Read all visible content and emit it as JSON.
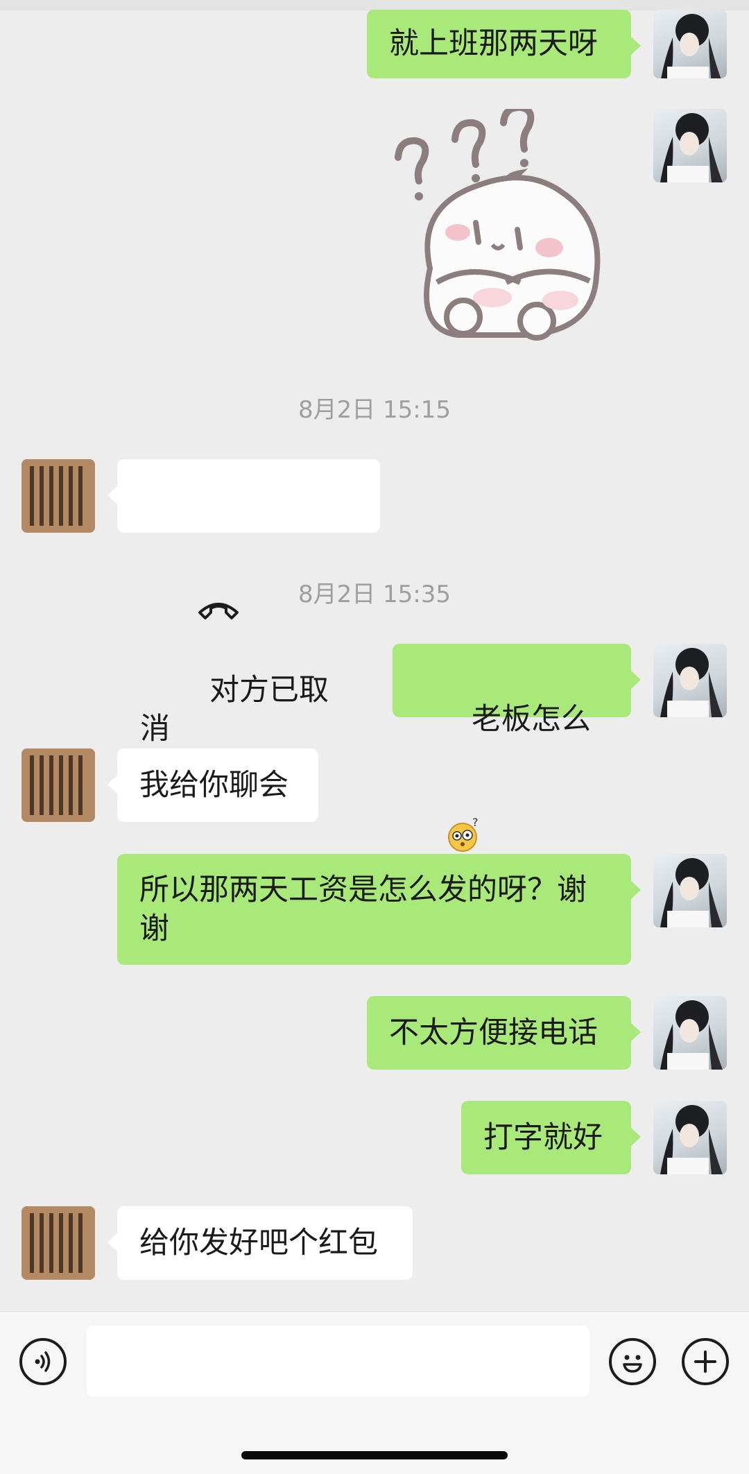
{
  "messages": [
    {
      "side": "me",
      "text": "就上班那两天呀"
    },
    {
      "side": "me",
      "kind": "sticker",
      "sticker": "confused-bun-sticker"
    },
    {
      "kind": "time",
      "text": "8月2日 15:15"
    },
    {
      "side": "them",
      "kind": "call",
      "text": "对方已取消"
    },
    {
      "kind": "time",
      "text": "8月2日 15:35"
    },
    {
      "side": "me",
      "text": "老板怎么了",
      "emoji": "thinking-face"
    },
    {
      "side": "them",
      "text": "我给你聊会"
    },
    {
      "side": "me",
      "text": "所以那两天工资是怎么发的呀？谢\n谢"
    },
    {
      "side": "me",
      "text": "不太方便接电话"
    },
    {
      "side": "me",
      "text": "打字就好"
    },
    {
      "side": "them",
      "text": "给你发好吧个红包"
    }
  ],
  "input": {
    "value": "",
    "placeholder": ""
  },
  "icons": {
    "voice": "voice-icon",
    "emoji": "smiley-icon",
    "plus": "plus-icon"
  },
  "colors": {
    "sent_bubble": "#a9e979",
    "received_bubble": "#ffffff",
    "background": "#ededed"
  }
}
